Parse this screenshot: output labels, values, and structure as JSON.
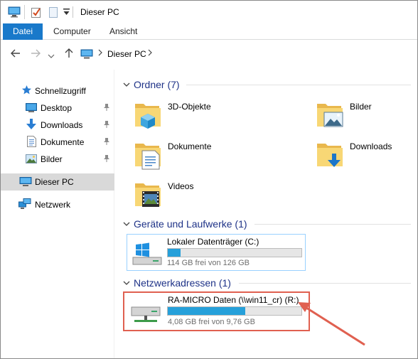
{
  "window": {
    "title": "Dieser PC"
  },
  "ribbon": {
    "tabs": [
      "Datei",
      "Computer",
      "Ansicht"
    ]
  },
  "address": {
    "location": "Dieser PC"
  },
  "sidebar": {
    "quick_access": "Schnellzugriff",
    "items": [
      {
        "label": "Desktop",
        "icon": "desktop-icon",
        "pinned": true
      },
      {
        "label": "Downloads",
        "icon": "download-icon",
        "pinned": true
      },
      {
        "label": "Dokumente",
        "icon": "document-icon",
        "pinned": true
      },
      {
        "label": "Bilder",
        "icon": "picture-icon",
        "pinned": true
      }
    ],
    "this_pc": "Dieser PC",
    "network": "Netzwerk"
  },
  "main": {
    "groups": {
      "folders": "Ordner (7)",
      "devices": "Geräte und Laufwerke (1)",
      "network": "Netzwerkadressen (1)"
    },
    "folders": [
      {
        "label": "3D-Objekte",
        "icon": "3d-objects-folder-icon"
      },
      {
        "label": "Bilder",
        "icon": "pictures-folder-icon"
      },
      {
        "label": "Dokumente",
        "icon": "documents-folder-icon"
      },
      {
        "label": "Downloads",
        "icon": "downloads-folder-icon"
      },
      {
        "label": "Videos",
        "icon": "videos-folder-icon"
      }
    ],
    "local_drive": {
      "name": "Lokaler Datenträger (C:)",
      "free": "114 GB frei von 126 GB",
      "used_fraction": 0.095
    },
    "network_drive": {
      "name": "RA-MICRO Daten (\\\\win11_cr) (R:)",
      "free": "4,08 GB frei von 9,76 GB",
      "used_fraction": 0.58
    }
  },
  "colors": {
    "accent": "#1979ca",
    "progress": "#26a0da",
    "group_title": "#1e3287",
    "highlight_border": "#e06050"
  }
}
